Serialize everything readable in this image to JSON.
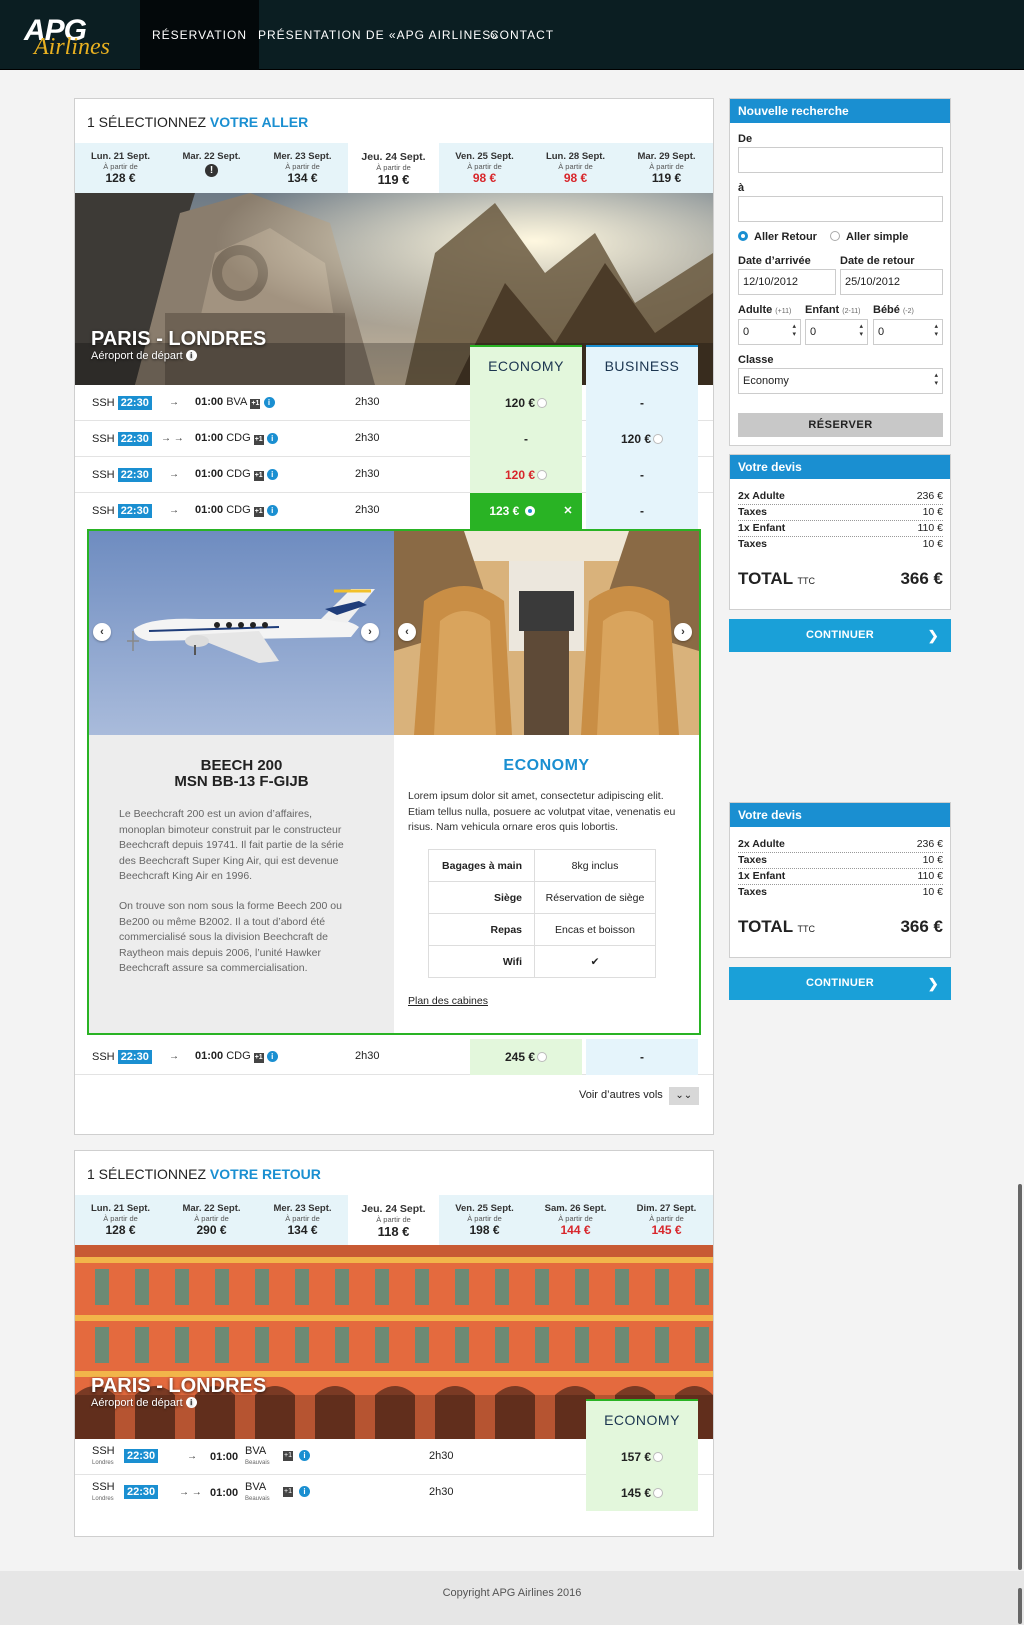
{
  "brand": {
    "line1": "APG",
    "line2": "Airlines"
  },
  "nav": [
    "RÉSERVATION",
    "PRÉSENTATION DE «APG AIRLINES»",
    "CONTACT"
  ],
  "outbound": {
    "title_prefix": "1 SÉLECTIONNEZ",
    "title_hl": "VOTRE ALLER",
    "dates": [
      {
        "day": "Lun. 21 Sept.",
        "from": "À partir de",
        "price": "128 €",
        "red": false
      },
      {
        "day": "Mar. 22 Sept.",
        "from": "",
        "price": "!",
        "red": false,
        "unavailable": true
      },
      {
        "day": "Mer. 23 Sept.",
        "from": "À partir de",
        "price": "134 €",
        "red": false
      },
      {
        "day": "Jeu. 24 Sept.",
        "from": "À partir de",
        "price": "119 €",
        "red": false,
        "selected": true
      },
      {
        "day": "Ven. 25 Sept.",
        "from": "À partir de",
        "price": "98 €",
        "red": true
      },
      {
        "day": "Lun. 28 Sept.",
        "from": "À partir de",
        "price": "98 €",
        "red": true
      },
      {
        "day": "Mar. 29 Sept.",
        "from": "À partir de",
        "price": "119 €",
        "red": false
      }
    ],
    "route": "PARIS - LONDRES",
    "route_sub": "Aéroport de départ",
    "class_eco": "ECONOMY",
    "class_bus": "BUSINESS",
    "flights": [
      {
        "code": "SSH",
        "dep": "22:30",
        "arrows": "→",
        "arr": "01:00",
        "airport": "BVA",
        "stops": "+1",
        "duration": "2h30",
        "eco": "120 €",
        "eco_red": false,
        "bus": "-"
      },
      {
        "code": "SSH",
        "dep": "22:30",
        "arrows": "→ →",
        "arr": "01:00",
        "airport": "CDG",
        "stops": "+1",
        "duration": "2h30",
        "eco": "-",
        "eco_red": false,
        "bus": "120 €"
      },
      {
        "code": "SSH",
        "dep": "22:30",
        "arrows": "→",
        "arr": "01:00",
        "airport": "CDG",
        "stops": "+1",
        "duration": "2h30",
        "eco": "120 €",
        "eco_red": true,
        "bus": "-"
      },
      {
        "code": "SSH",
        "dep": "22:30",
        "arrows": "→",
        "arr": "01:00",
        "airport": "CDG",
        "stops": "+1",
        "duration": "2h30",
        "eco": "123 €",
        "eco_red": false,
        "bus": "-",
        "selected": true
      },
      {
        "code": "SSH",
        "dep": "22:30",
        "arrows": "→",
        "arr": "01:00",
        "airport": "CDG",
        "stops": "+1",
        "duration": "2h30",
        "eco": "245 €",
        "eco_red": false,
        "bus": "-"
      }
    ],
    "detail": {
      "aircraft_line1": "BEECH 200",
      "aircraft_line2": "MSN BB-13 F-GIJB",
      "aircraft_desc1": "Le Beechcraft 200 est un avion d’affaires, monoplan bimoteur construit par le constructeur Beechcraft depuis 19741. Il fait partie de la série des Beechcraft Super King Air, qui est devenue Beechcraft King Air en 1996.",
      "aircraft_desc2": "On trouve son nom sous la forme Beech 200 ou Be200 ou même B2002. Il a tout d’abord été commercialisé sous la division Beechcraft de Raytheon mais depuis 2006, l’unité Hawker Beechcraft assure sa commercialisation.",
      "class_title": "ECONOMY",
      "class_desc": "Lorem ipsum dolor sit amet, consectetur adipiscing elit. Etiam tellus nulla, posuere ac volutpat vitae, venenatis eu risus. Nam vehicula ornare eros quis lobortis.",
      "features": [
        {
          "k": "Bagages à main",
          "v": "8kg inclus"
        },
        {
          "k": "Siège",
          "v": "Réservation de siège"
        },
        {
          "k": "Repas",
          "v": "Encas et boisson"
        },
        {
          "k": "Wifi",
          "v": "✔"
        }
      ],
      "plan_link": "Plan des cabines"
    },
    "more": "Voir d’autres vols"
  },
  "return": {
    "title_prefix": "1 SÉLECTIONNEZ",
    "title_hl": "VOTRE RETOUR",
    "dates": [
      {
        "day": "Lun. 21 Sept.",
        "from": "À partir de",
        "price": "128 €",
        "red": false
      },
      {
        "day": "Mar. 22 Sept.",
        "from": "À partir de",
        "price": "290 €",
        "red": false
      },
      {
        "day": "Mer. 23 Sept.",
        "from": "À partir de",
        "price": "134 €",
        "red": false
      },
      {
        "day": "Jeu. 24 Sept.",
        "from": "À partir de",
        "price": "118 €",
        "red": false,
        "selected": true
      },
      {
        "day": "Ven. 25 Sept.",
        "from": "À partir de",
        "price": "198 €",
        "red": false
      },
      {
        "day": "Sam. 26 Sept.",
        "from": "À partir de",
        "price": "144 €",
        "red": true
      },
      {
        "day": "Dim. 27 Sept.",
        "from": "À partir de",
        "price": "145 €",
        "red": true
      }
    ],
    "route": "PARIS - LONDRES",
    "route_sub": "Aéroport de départ",
    "class_eco": "ECONOMY",
    "flights": [
      {
        "code": "SSH",
        "code_sub": "Londres",
        "dep": "22:30",
        "arrows": "→",
        "arr": "01:00",
        "airport": "BVA",
        "airport_sub": "Beauvais",
        "stops": "+1",
        "duration": "2h30",
        "eco": "157 €"
      },
      {
        "code": "SSH",
        "code_sub": "Londres",
        "dep": "22:30",
        "arrows": "→ →",
        "arr": "01:00",
        "airport": "BVA",
        "airport_sub": "Beauvais",
        "stops": "+1",
        "duration": "2h30",
        "eco": "145 €"
      }
    ]
  },
  "search": {
    "title": "Nouvelle recherche",
    "from_label": "De",
    "from_value": "",
    "to_label": "à",
    "to_value": "",
    "trip_rt": "Aller Retour",
    "trip_ow": "Aller simple",
    "arrival_label": "Date d’arrivée",
    "arrival_value": "12/10/2012",
    "return_label": "Date de retour",
    "return_value": "25/10/2012",
    "adult_label": "Adulte",
    "adult_hint": "(+11)",
    "adult_value": "0",
    "child_label": "Enfant",
    "child_hint": "(2-11)",
    "child_value": "0",
    "baby_label": "Bébé",
    "baby_hint": "(-2)",
    "baby_value": "0",
    "class_label": "Classe",
    "class_value": "Economy",
    "submit": "RÉSERVER"
  },
  "quote": {
    "title": "Votre devis",
    "lines": [
      {
        "k": "2x Adulte",
        "v": "236 €"
      },
      {
        "k": "Taxes",
        "v": "10 €"
      },
      {
        "k": "1x Enfant",
        "v": "110 €"
      },
      {
        "k": "Taxes",
        "v": "10 €"
      }
    ],
    "total_label": "TOTAL",
    "total_suffix": "TTC",
    "total_value": "366 €",
    "continue": "CONTINUER"
  },
  "footer": "Copyright APG Airlines 2016",
  "colors": {
    "accent": "#1a8fd1",
    "economy": "#29b324",
    "price_red": "#d8262b",
    "header": "#0b1e22"
  }
}
